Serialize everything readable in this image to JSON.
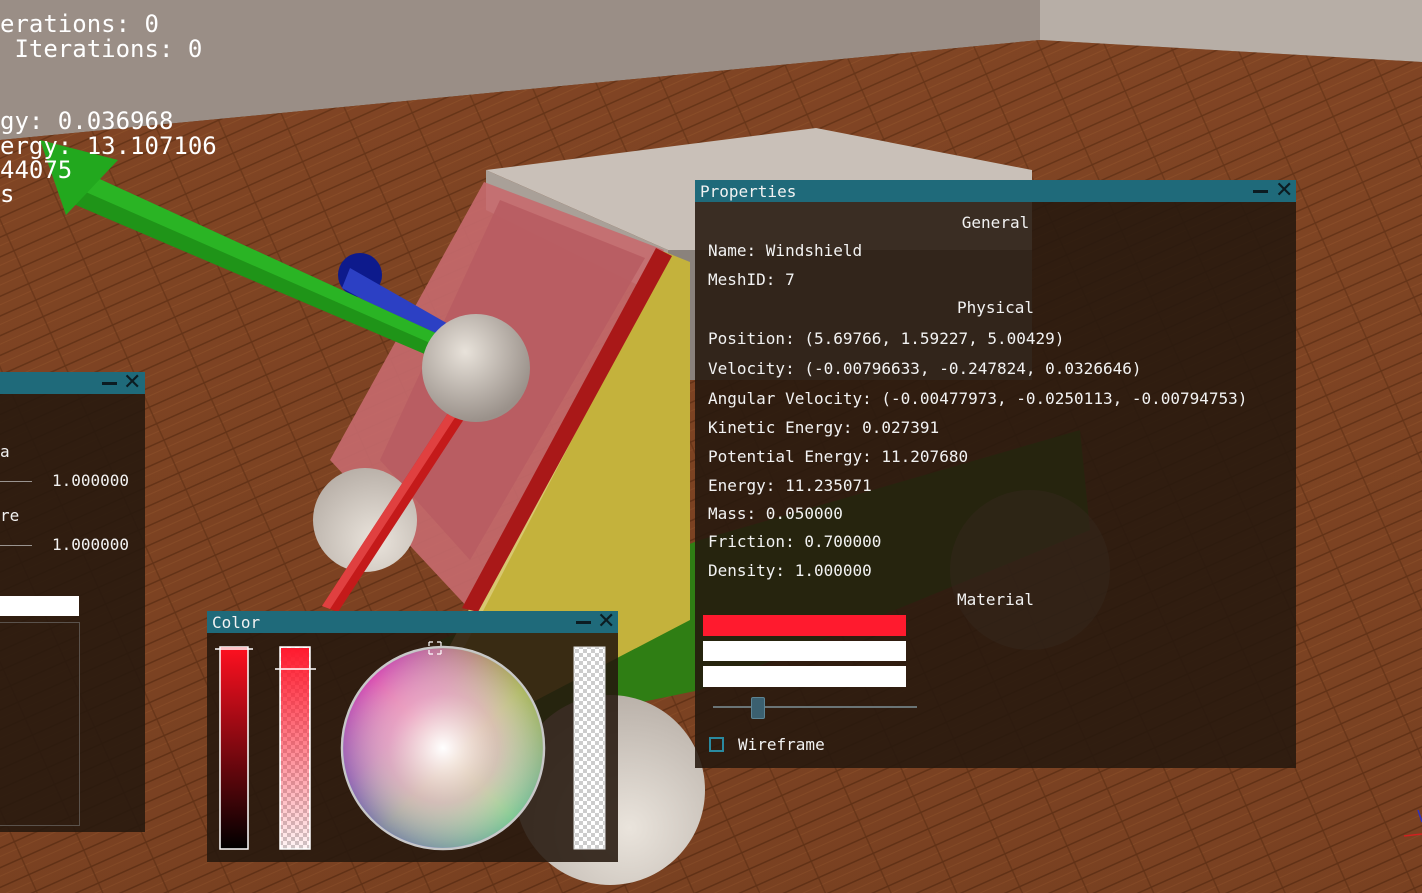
{
  "hud": {
    "lines": [
      "erations: 0",
      " Iterations: 0",
      "gy: 0.036968",
      "ergy: 13.107106",
      "44075",
      "s"
    ]
  },
  "properties": {
    "title": "Properties",
    "sections": {
      "general": "General",
      "physical": "Physical",
      "material": "Material"
    },
    "name": "Name: Windshield",
    "mesh_id": "MeshID: 7",
    "position": "Position: (5.69766, 1.59227, 5.00429)",
    "velocity": "Velocity: (-0.00796633, -0.247824, 0.0326646)",
    "angular_velocity": "Angular Velocity: (-0.00477973, -0.0250113, -0.00794753)",
    "kinetic_energy": "Kinetic Energy: 0.027391",
    "potential_energy": "Potential Energy: 11.207680",
    "energy": "Energy: 11.235071",
    "mass": "Mass: 0.050000",
    "friction": "Friction: 0.700000",
    "density": "Density: 1.000000",
    "material_colors": [
      "#ff1a2e",
      "#ffffff",
      "#ffffff"
    ],
    "slider_value_fraction": 0.2,
    "wireframe_label": "Wireframe",
    "wireframe_checked": false
  },
  "left_panel": {
    "label_a": "a",
    "value_a": "1.000000",
    "label_b": "re",
    "value_b": "1.000000"
  },
  "color_window": {
    "title": "Color",
    "selected_color": "#ff1a2e",
    "alpha_fraction": 1.0
  },
  "colors": {
    "title_bar": "#1f6a7a",
    "panel_bg": "#26180e",
    "floor": "#7a4424",
    "wall": "#8c8078",
    "arrow_green": "#22a81e",
    "rod_red": "#c41a1a",
    "windshield": "#c86a6a",
    "side_yellow": "#c8b43a"
  }
}
